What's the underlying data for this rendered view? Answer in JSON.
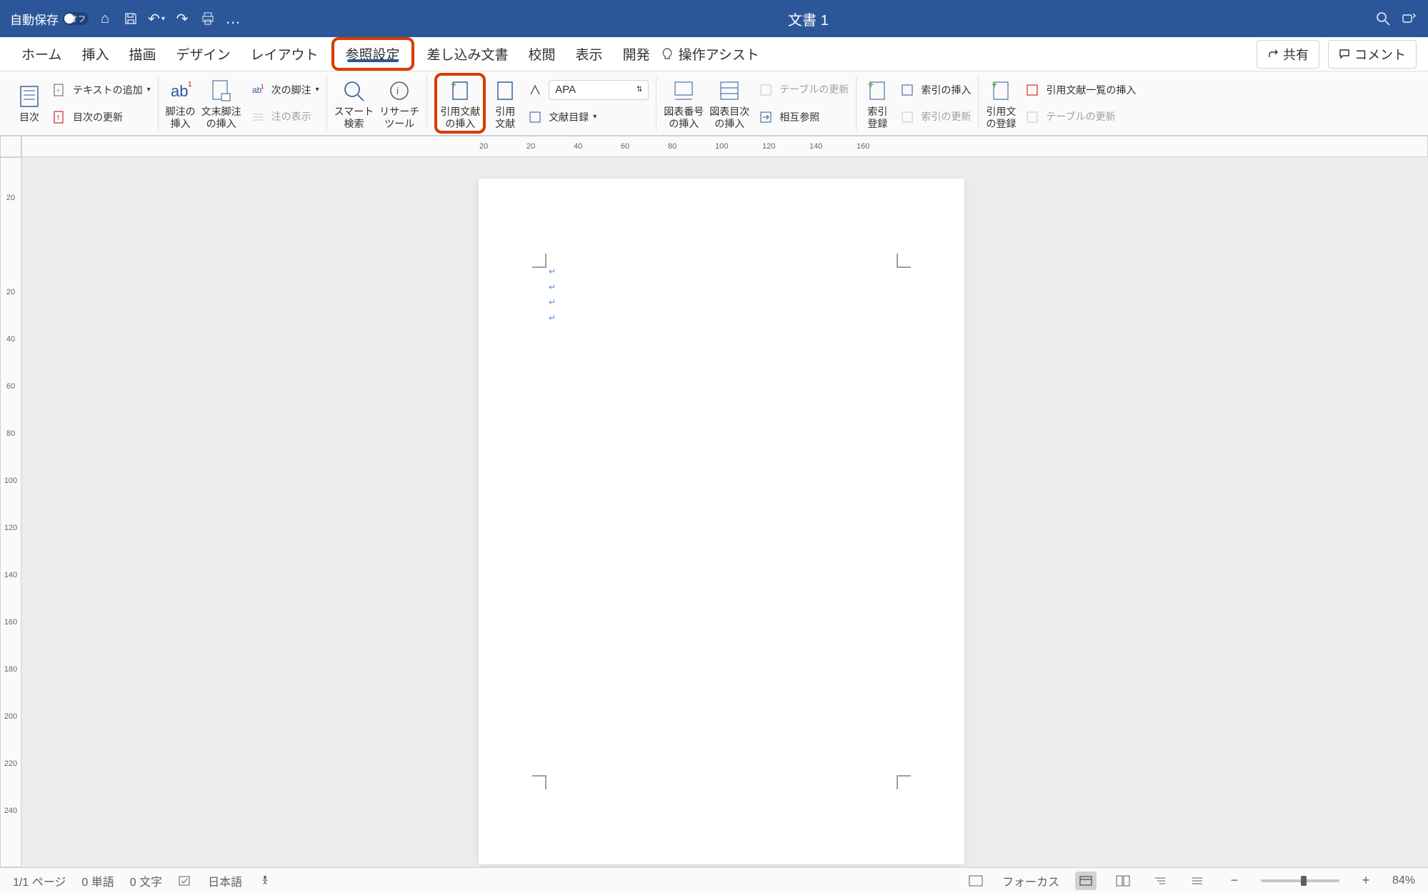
{
  "titlebar": {
    "autosave_label": "自動保存",
    "autosave_state": "オフ",
    "doc_title": "文書 1"
  },
  "tabs": {
    "home": "ホーム",
    "insert": "挿入",
    "draw": "描画",
    "design": "デザイン",
    "layout": "レイアウト",
    "references": "参照設定",
    "mailings": "差し込み文書",
    "review": "校閲",
    "view": "表示",
    "developer": "開発",
    "tellme": "操作アシスト",
    "share": "共有",
    "comments": "コメント"
  },
  "ribbon": {
    "toc": "目次",
    "add_text": "テキストの追加",
    "update_toc": "目次の更新",
    "insert_footnote": "脚注の\n挿入",
    "insert_endnote": "文末脚注\nの挿入",
    "next_footnote": "次の脚注",
    "show_notes": "注の表示",
    "smart_lookup": "スマート\n検索",
    "research": "リサーチ\nツール",
    "insert_citation": "引用文献\nの挿入",
    "citations": "引用\n文献",
    "style_value": "APA",
    "bibliography": "文献目録",
    "insert_caption": "図表番号\nの挿入",
    "insert_table_figures": "図表目次\nの挿入",
    "update_table": "テーブルの更新",
    "cross_ref": "相互参照",
    "insert_index": "索引\n登録",
    "insert_index_entry": "索引の挿入",
    "update_index": "索引の更新",
    "insert_cit_src": "引用文\nの登録",
    "insert_cit_list": "引用文献一覧の挿入",
    "update_table2": "テーブルの更新"
  },
  "ruler_h": [
    "20",
    "20",
    "40",
    "60",
    "80",
    "100",
    "120",
    "140",
    "160"
  ],
  "ruler_v": [
    "20",
    "",
    "20",
    "40",
    "60",
    "80",
    "100",
    "120",
    "140",
    "160",
    "180",
    "200",
    "220",
    "240"
  ],
  "page_lines": [
    "↵",
    "↵",
    "↵",
    "↵"
  ],
  "statusbar": {
    "page": "1/1 ページ",
    "words": "0 単語",
    "chars": "0 文字",
    "lang": "日本語",
    "focus": "フォーカス",
    "zoom": "84%"
  }
}
